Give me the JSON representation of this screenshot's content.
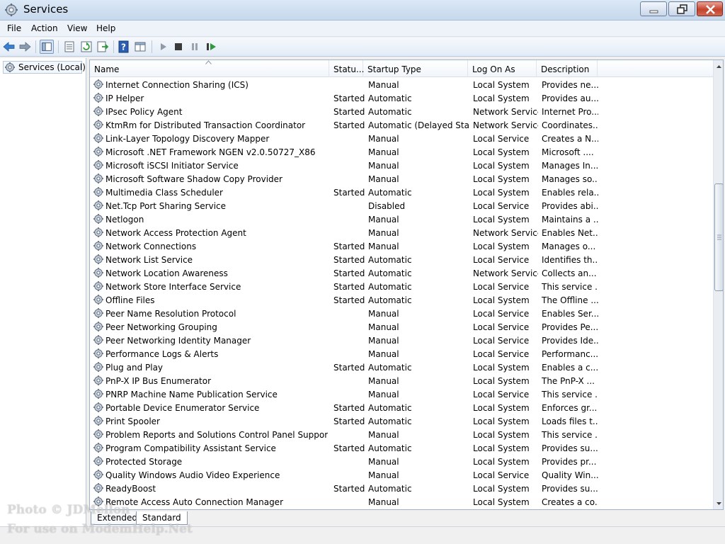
{
  "window": {
    "title": "Services"
  },
  "menu": [
    "File",
    "Action",
    "View",
    "Help"
  ],
  "tree": {
    "item": "Services (Local)"
  },
  "columns": {
    "name": "Name",
    "status": "Statu...",
    "startup": "Startup Type",
    "logon": "Log On As",
    "description": "Description"
  },
  "rows": [
    {
      "name": "Internet Connection Sharing (ICS)",
      "status": "",
      "startup": "Manual",
      "logon": "Local System",
      "desc": "Provides ne..."
    },
    {
      "name": "IP Helper",
      "status": "Started",
      "startup": "Automatic",
      "logon": "Local System",
      "desc": "Provides au..."
    },
    {
      "name": "IPsec Policy Agent",
      "status": "Started",
      "startup": "Automatic",
      "logon": "Network Service",
      "desc": "Internet Pro..."
    },
    {
      "name": "KtmRm for Distributed Transaction Coordinator",
      "status": "Started",
      "startup": "Automatic (Delayed Start)",
      "logon": "Network Service",
      "desc": "Coordinates..."
    },
    {
      "name": "Link-Layer Topology Discovery Mapper",
      "status": "",
      "startup": "Manual",
      "logon": "Local Service",
      "desc": "Creates a N..."
    },
    {
      "name": "Microsoft .NET Framework NGEN v2.0.50727_X86",
      "status": "",
      "startup": "Manual",
      "logon": "Local System",
      "desc": "Microsoft ...."
    },
    {
      "name": "Microsoft iSCSI Initiator Service",
      "status": "",
      "startup": "Manual",
      "logon": "Local System",
      "desc": "Manages In..."
    },
    {
      "name": "Microsoft Software Shadow Copy Provider",
      "status": "",
      "startup": "Manual",
      "logon": "Local System",
      "desc": "Manages so..."
    },
    {
      "name": "Multimedia Class Scheduler",
      "status": "Started",
      "startup": "Automatic",
      "logon": "Local System",
      "desc": "Enables rela..."
    },
    {
      "name": "Net.Tcp Port Sharing Service",
      "status": "",
      "startup": "Disabled",
      "logon": "Local Service",
      "desc": "Provides abi..."
    },
    {
      "name": "Netlogon",
      "status": "",
      "startup": "Manual",
      "logon": "Local System",
      "desc": "Maintains a ..."
    },
    {
      "name": "Network Access Protection Agent",
      "status": "",
      "startup": "Manual",
      "logon": "Network Service",
      "desc": "Enables Net..."
    },
    {
      "name": "Network Connections",
      "status": "Started",
      "startup": "Manual",
      "logon": "Local System",
      "desc": "Manages o..."
    },
    {
      "name": "Network List Service",
      "status": "Started",
      "startup": "Automatic",
      "logon": "Local Service",
      "desc": "Identifies th..."
    },
    {
      "name": "Network Location Awareness",
      "status": "Started",
      "startup": "Automatic",
      "logon": "Network Service",
      "desc": "Collects an..."
    },
    {
      "name": "Network Store Interface Service",
      "status": "Started",
      "startup": "Automatic",
      "logon": "Local Service",
      "desc": "This service ..."
    },
    {
      "name": "Offline Files",
      "status": "Started",
      "startup": "Automatic",
      "logon": "Local System",
      "desc": "The Offline ..."
    },
    {
      "name": "Peer Name Resolution Protocol",
      "status": "",
      "startup": "Manual",
      "logon": "Local Service",
      "desc": "Enables Ser..."
    },
    {
      "name": "Peer Networking Grouping",
      "status": "",
      "startup": "Manual",
      "logon": "Local Service",
      "desc": "Provides Pe..."
    },
    {
      "name": "Peer Networking Identity Manager",
      "status": "",
      "startup": "Manual",
      "logon": "Local Service",
      "desc": "Provides Ide..."
    },
    {
      "name": "Performance Logs & Alerts",
      "status": "",
      "startup": "Manual",
      "logon": "Local Service",
      "desc": "Performanc..."
    },
    {
      "name": "Plug and Play",
      "status": "Started",
      "startup": "Automatic",
      "logon": "Local System",
      "desc": "Enables a c..."
    },
    {
      "name": "PnP-X IP Bus Enumerator",
      "status": "",
      "startup": "Manual",
      "logon": "Local System",
      "desc": "The PnP-X ..."
    },
    {
      "name": "PNRP Machine Name Publication Service",
      "status": "",
      "startup": "Manual",
      "logon": "Local Service",
      "desc": "This service ..."
    },
    {
      "name": "Portable Device Enumerator Service",
      "status": "Started",
      "startup": "Automatic",
      "logon": "Local System",
      "desc": "Enforces gr..."
    },
    {
      "name": "Print Spooler",
      "status": "Started",
      "startup": "Automatic",
      "logon": "Local System",
      "desc": "Loads files t..."
    },
    {
      "name": "Problem Reports and Solutions Control Panel Support",
      "status": "",
      "startup": "Manual",
      "logon": "Local System",
      "desc": "This service ..."
    },
    {
      "name": "Program Compatibility Assistant Service",
      "status": "Started",
      "startup": "Automatic",
      "logon": "Local System",
      "desc": "Provides su..."
    },
    {
      "name": "Protected Storage",
      "status": "",
      "startup": "Manual",
      "logon": "Local System",
      "desc": "Provides pr..."
    },
    {
      "name": "Quality Windows Audio Video Experience",
      "status": "",
      "startup": "Manual",
      "logon": "Local Service",
      "desc": "Quality Win..."
    },
    {
      "name": "ReadyBoost",
      "status": "Started",
      "startup": "Automatic",
      "logon": "Local System",
      "desc": "Provides su..."
    },
    {
      "name": "Remote Access Auto Connection Manager",
      "status": "",
      "startup": "Manual",
      "logon": "Local System",
      "desc": "Creates a co..."
    }
  ],
  "tabs": [
    "Extended",
    "Standard"
  ],
  "watermark": {
    "line1": "Photo © JDMellon",
    "line2": "For use on ModemHelp.Net"
  }
}
